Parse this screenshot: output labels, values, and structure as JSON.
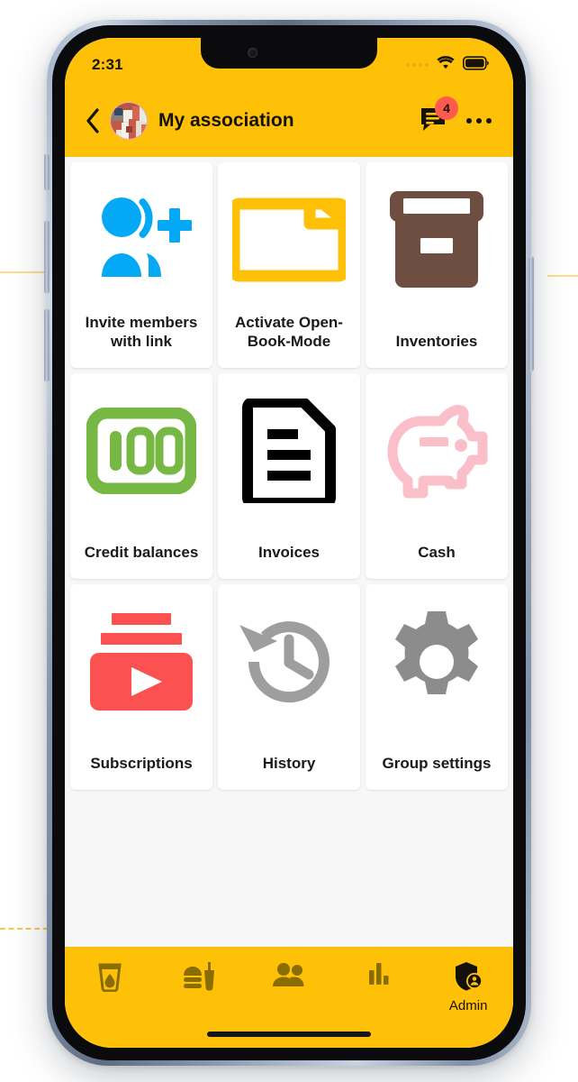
{
  "status_bar": {
    "time": "2:31",
    "signal_icon": "signal-dots-icon",
    "wifi_icon": "wifi-icon",
    "battery_icon": "battery-full-icon"
  },
  "app_bar": {
    "back_icon": "back-chevron-icon",
    "avatar_icon": "group-avatar-photo",
    "title": "My association",
    "chat_icon": "chat-bubble-icon",
    "chat_badge": "4",
    "overflow_icon": "more-options-icon"
  },
  "grid": {
    "tiles": [
      {
        "label": "Invite members with link",
        "icon": "person-add-icon",
        "color": "#03A9F4"
      },
      {
        "label": "Activate Open-Book-Mode",
        "icon": "folder-icon",
        "color": "#FFC107"
      },
      {
        "label": "Inventories",
        "icon": "archive-box-icon",
        "color": "#6F4E42"
      },
      {
        "label": "Credit balances",
        "icon": "hundred-banknote-icon",
        "color": "#76B843"
      },
      {
        "label": "Invoices",
        "icon": "document-lines-icon",
        "color": "#000000"
      },
      {
        "label": "Cash",
        "icon": "piggy-bank-icon",
        "color": "#FBBFC9"
      },
      {
        "label": "Subscriptions",
        "icon": "subscriptions-play-icon",
        "color": "#FB5151"
      },
      {
        "label": "History",
        "icon": "history-clock-icon",
        "color": "#9E9E9E"
      },
      {
        "label": "Group settings",
        "icon": "gear-icon",
        "color": "#8C8C8C"
      }
    ]
  },
  "bottom_nav": {
    "items": [
      {
        "label": "",
        "icon": "drink-glass-icon",
        "active": false
      },
      {
        "label": "",
        "icon": "food-burger-icon",
        "active": false
      },
      {
        "label": "",
        "icon": "people-icon",
        "active": false
      },
      {
        "label": "",
        "icon": "bar-chart-icon",
        "active": false
      },
      {
        "label": "Admin",
        "icon": "shield-person-icon",
        "active": true
      }
    ]
  },
  "theme": {
    "accent": "#FFC107",
    "badge": "#FF5A4E",
    "surface": "#FFFFFF",
    "background": "#F7F7F7",
    "nav_icon": "#8A6D00"
  }
}
